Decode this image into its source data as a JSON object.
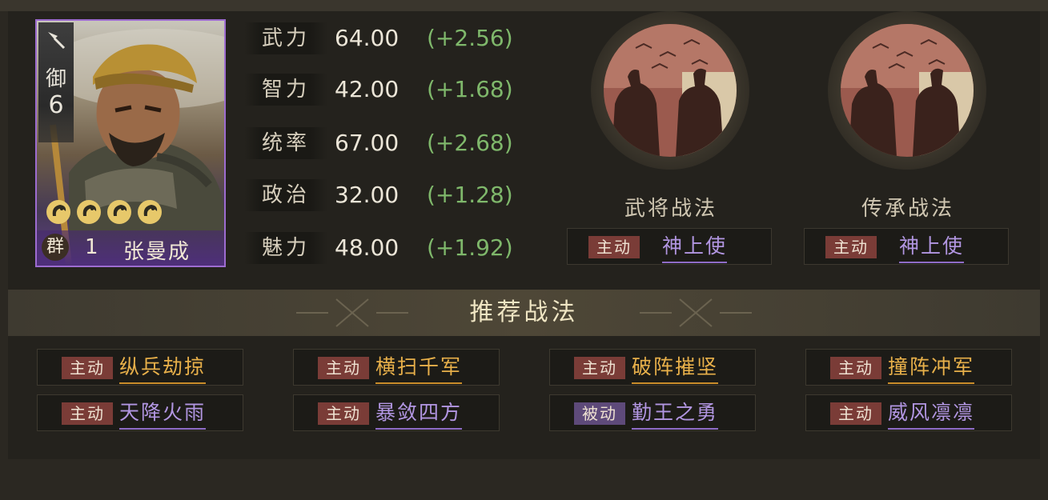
{
  "hero": {
    "class_char": "御",
    "class_level": "6",
    "faction": "群",
    "cost": "1",
    "name": "张曼成",
    "stars": 4
  },
  "attributes": [
    {
      "label": "武力",
      "value": "64.00",
      "bonus": "(+2.56)"
    },
    {
      "label": "智力",
      "value": "42.00",
      "bonus": "(+1.68)"
    },
    {
      "label": "统率",
      "value": "67.00",
      "bonus": "(+2.68)"
    },
    {
      "label": "政治",
      "value": "32.00",
      "bonus": "(+1.28)"
    },
    {
      "label": "魅力",
      "value": "48.00",
      "bonus": "(+1.92)"
    }
  ],
  "tactic_slots": [
    {
      "title": "武将战法",
      "type": "主动",
      "skill": "神上使"
    },
    {
      "title": "传承战法",
      "type": "主动",
      "skill": "神上使"
    }
  ],
  "recommended": {
    "title": "推荐战法",
    "items": [
      {
        "type": "主动",
        "name": "纵兵劫掠",
        "color": "gold"
      },
      {
        "type": "主动",
        "name": "横扫千军",
        "color": "gold"
      },
      {
        "type": "主动",
        "name": "破阵摧坚",
        "color": "gold"
      },
      {
        "type": "主动",
        "name": "撞阵冲军",
        "color": "gold"
      },
      {
        "type": "主动",
        "name": "天降火雨",
        "color": "purple"
      },
      {
        "type": "主动",
        "name": "暴敛四方",
        "color": "purple"
      },
      {
        "type": "被动",
        "name": "勤王之勇",
        "color": "purple"
      },
      {
        "type": "主动",
        "name": "威风凛凛",
        "color": "purple"
      }
    ]
  },
  "colors": {
    "active_badge": "#7a3c37",
    "passive_badge": "#5e4a7a",
    "gold_skill": "#e8b04a",
    "purple_skill": "#b296e2",
    "bonus_green": "#7fb86b",
    "card_border": "#9d6cd0"
  }
}
